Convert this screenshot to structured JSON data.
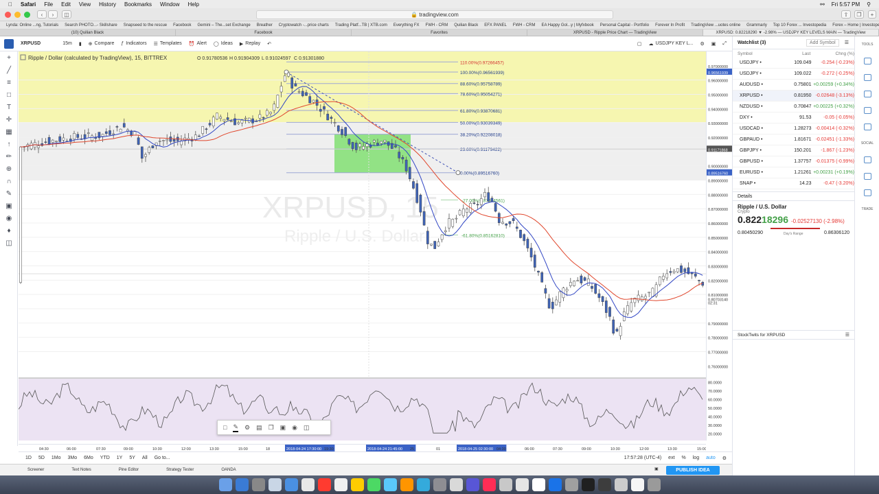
{
  "menubar": {
    "apple": "",
    "app": "Safari",
    "items": [
      "File",
      "Edit",
      "View",
      "History",
      "Bookmarks",
      "Window",
      "Help"
    ],
    "clock": "Fri 5:57 PM"
  },
  "browser": {
    "url": "tradingview.com"
  },
  "bookmarks": [
    "Lynda: Online ...ng, Tutorials",
    "Search PHOTO...- Skillshare",
    "Snapseed to the rescue",
    "Facebook",
    "Gemini – The...set Exchange",
    "Breather",
    "Cryptowatch -...price charts",
    "Trading Platf...TB | XTB.com",
    "Everything FX",
    "FWH - CRM",
    "Quilian Black",
    "EFX PANEL",
    "FWH - CRM",
    "EA Happy Gol...y | Myfxbook",
    "Personal Capital - Portfolio",
    "Forever In Profit",
    "TradingView ...uotes online",
    "Grammarly",
    "Top 10 Forex ... Investopedia",
    "Forex – Home | Investopedia"
  ],
  "tabs": [
    "(10) Quilian Black",
    "Facebook",
    "Favorites",
    "XRPUSD - Ripple Price Chart — TradingView",
    "XRPUSD: 0.82218290 ▼ -2.98% — USDJPY KEY LEVELS MAIN — TradingView"
  ],
  "tvtop": {
    "symbol": "XRPUSD",
    "interval": "15m",
    "compare": "Compare",
    "indicators": "Indicators",
    "templates": "Templates",
    "alert": "Alert",
    "ideas": "Ideas",
    "replay": "Replay",
    "layout": "USDJPY KEY L..."
  },
  "legend": {
    "title": "Ripple / Dollar (calculated by TradingView), 15, BITTREX",
    "o": "O 0.91780536",
    "h": "H 0.91904309",
    "l": "L 0.91024597",
    "c": "C 0.91301880"
  },
  "watermark": {
    "big": "XRPUSD, 15",
    "small": "Ripple / U.S. Dollar"
  },
  "fib": [
    {
      "label": "110.00%(0.97266457)",
      "color": "#d32f2f"
    },
    {
      "label": "100.00%(0.96561939)",
      "color": "#1e3a8a"
    },
    {
      "label": "88.60%(0.95758789)",
      "color": "#1e3a8a"
    },
    {
      "label": "78.60%(0.95054271)",
      "color": "#1e3a8a"
    },
    {
      "label": "61.80%(0.93870681)",
      "color": "#1e3a8a"
    },
    {
      "label": "50.00%(0.93039349)",
      "color": "#1e3a8a"
    },
    {
      "label": "38.20%(0.92208018)",
      "color": "#1e3a8a"
    },
    {
      "label": "23.60%(0.91179422)",
      "color": "#1e3a8a"
    },
    {
      "label": "0.00%(0.89516760)",
      "color": "#1e3a8a"
    },
    {
      "label": "-27.00%(0.87614561)",
      "color": "#43a047"
    },
    {
      "label": "-61.80%(0.85162810)",
      "color": "#43a047"
    }
  ],
  "price_axis": [
    "0.97000000",
    "0.96561939",
    "0.96000000",
    "0.95000000",
    "0.94000000",
    "0.93000000",
    "0.92000000",
    "0.91171868",
    "0.90000000",
    "0.89516760",
    "0.89000000",
    "0.88000000",
    "0.87000000",
    "0.86000000",
    "0.85000000",
    "0.84000000",
    "0.83000000",
    "0.82000000",
    "0.81000000",
    "0.80703140",
    "02:31",
    "0.79000000",
    "0.78000000",
    "0.77000000",
    "0.76000000"
  ],
  "osc_axis": [
    "80.0000",
    "70.0000",
    "60.0000",
    "50.0000",
    "40.0000",
    "30.0000",
    "20.0000"
  ],
  "time_axis": [
    "04:30",
    "06:00",
    "07:30",
    "09:00",
    "10:30",
    "12:00",
    "13:30",
    "15:00",
    "18",
    "2018-04-24 17:30:00",
    "19:30",
    "2018-04-24 21:45:00",
    "25",
    "01",
    "2018-04-25 02:30:00",
    "04:30",
    "06:00",
    "07:30",
    "09:00",
    "10:30",
    "12:00",
    "13:30",
    "15:00"
  ],
  "bottombar": {
    "ranges": [
      "1D",
      "5D",
      "1Mo",
      "3Mo",
      "6Mo",
      "YTD",
      "1Y",
      "5Y",
      "All"
    ],
    "goto": "Go to...",
    "clock": "17:57:28 (UTC-4)",
    "ext": "ext",
    "pct": "%",
    "log": "log",
    "auto": "auto"
  },
  "panel": {
    "tabs": [
      "Screener",
      "Text Notes",
      "Pine Editor",
      "Strategy Tester",
      "OANDA"
    ],
    "publish": "PUBLISH IDEA"
  },
  "watchlist": {
    "title": "Watchlist (3)",
    "add": "Add Symbol",
    "cols": [
      "Symbol",
      "Last",
      "Chng (%)"
    ],
    "rows": [
      {
        "s": "USDJPY",
        "l": "109.049",
        "c": "-0.254 (-0.23%)",
        "up": false
      },
      {
        "s": "USDJPY",
        "l": "109.022",
        "c": "-0.272 (-0.25%)",
        "up": false
      },
      {
        "s": "AUDUSD",
        "l": "0.75801",
        "c": "+0.00259 (+0.34%)",
        "up": true
      },
      {
        "s": "XRPUSD",
        "l": "0.81950",
        "c": "-0.02648 (-3.13%)",
        "up": false
      },
      {
        "s": "NZDUSD",
        "l": "0.70847",
        "c": "+0.00225 (+0.32%)",
        "up": true
      },
      {
        "s": "DXY",
        "l": "91.53",
        "c": "-0.05 (-0.05%)",
        "up": false
      },
      {
        "s": "USDCAD",
        "l": "1.28273",
        "c": "-0.00414 (-0.32%)",
        "up": false
      },
      {
        "s": "GBPAUD",
        "l": "1.81671",
        "c": "-0.02451 (-1.33%)",
        "up": false
      },
      {
        "s": "GBPJPY",
        "l": "150.201",
        "c": "-1.867 (-1.23%)",
        "up": false
      },
      {
        "s": "GBPUSD",
        "l": "1.37757",
        "c": "-0.01375 (-0.99%)",
        "up": false
      },
      {
        "s": "EURUSD",
        "l": "1.21261",
        "c": "+0.00231 (+0.19%)",
        "up": true
      },
      {
        "s": "SNAP",
        "l": "14.23",
        "c": "-0.47 (-3.20%)",
        "up": false
      }
    ],
    "details_title": "Details",
    "pair": "Ripple / U.S. Dollar",
    "type": "Crypto",
    "price_main": "0.822",
    "price_tail": "18296",
    "change": "-0.02527130 (-2.98%)",
    "low": "0.80450290",
    "range_label": "Day's Range",
    "high": "0.86306120",
    "stocktwits": "StockTwits for XRPUSD"
  },
  "rightstrip": [
    "TOOLS",
    "",
    "",
    "",
    "",
    "",
    "SOCIAL",
    "",
    "",
    "",
    "TRADE"
  ]
}
